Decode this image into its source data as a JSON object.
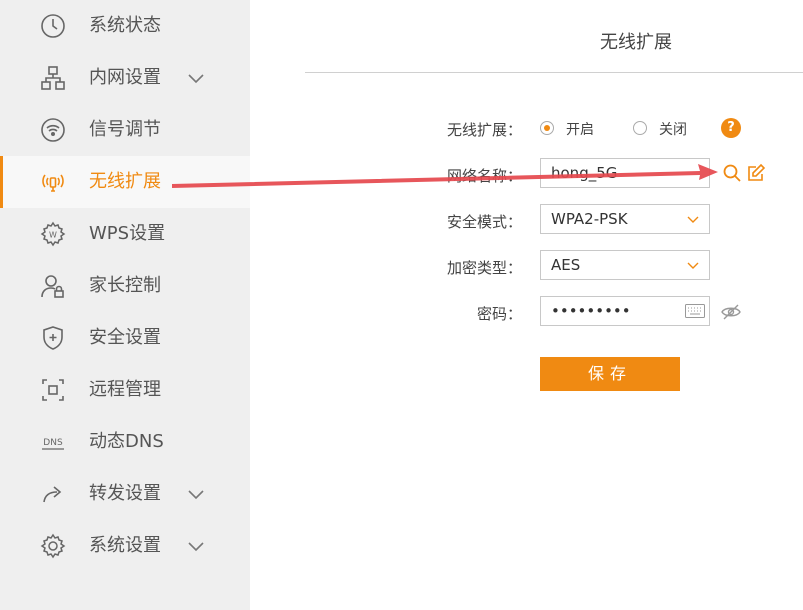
{
  "sidebar": {
    "items": [
      {
        "label": "系统状态",
        "icon": "clock-icon"
      },
      {
        "label": "内网设置",
        "icon": "network-icon",
        "has_submenu": true
      },
      {
        "label": "信号调节",
        "icon": "signal-icon"
      },
      {
        "label": "无线扩展",
        "icon": "wireless-extend-icon",
        "active": true
      },
      {
        "label": "WPS设置",
        "icon": "wps-gear-icon"
      },
      {
        "label": "家长控制",
        "icon": "parental-control-icon"
      },
      {
        "label": "安全设置",
        "icon": "shield-icon"
      },
      {
        "label": "远程管理",
        "icon": "remote-management-icon"
      },
      {
        "label": "动态DNS",
        "icon": "dns-icon"
      },
      {
        "label": "转发设置",
        "icon": "forward-icon",
        "has_submenu": true
      },
      {
        "label": "系统设置",
        "icon": "settings-gear-icon",
        "has_submenu": true
      }
    ]
  },
  "main": {
    "title": "无线扩展",
    "extend": {
      "label": "无线扩展：",
      "option_on": "开启",
      "option_off": "关闭",
      "selected": "开启",
      "help": "?"
    },
    "ssid": {
      "label": "网络名称：",
      "value": "hong_5G"
    },
    "security_mode": {
      "label": "安全模式：",
      "value": "WPA2-PSK"
    },
    "encryption": {
      "label": "加密类型：",
      "value": "AES"
    },
    "password": {
      "label": "密码：",
      "value": "•••••••••"
    },
    "save_label": "保存"
  },
  "colors": {
    "accent": "#f08a12",
    "annotation_arrow": "#e5484d",
    "sidebar_bg": "#efefef"
  }
}
